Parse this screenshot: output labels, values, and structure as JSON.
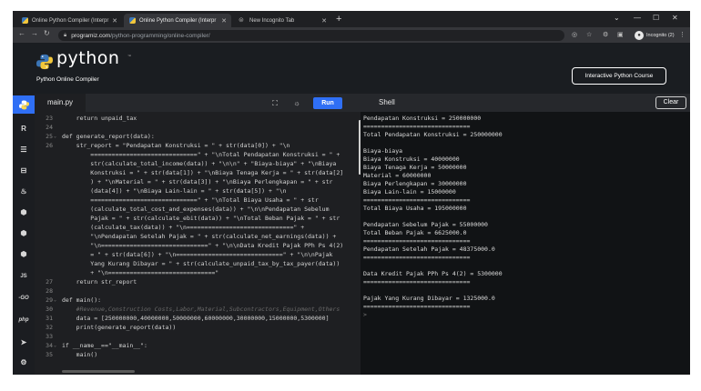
{
  "browser": {
    "tabs": [
      {
        "title": "Online Python Compiler (Interpr",
        "active": false
      },
      {
        "title": "Online Python Compiler (Interpr",
        "active": true
      },
      {
        "title": "New Incognito Tab",
        "active": false
      }
    ],
    "url_domain": "programiz.com",
    "url_path": "/python-programming/online-compiler/",
    "profile_label": "Incognito (2)"
  },
  "site": {
    "logo_text": "python",
    "logo_tm": "™",
    "subtitle": "Python Online Compiler",
    "course_button": "Interactive Python Course"
  },
  "sidebar": {
    "icons": [
      "python-icon",
      "r-icon",
      "sql-icon",
      "html-icon",
      "java-icon",
      "c-icon",
      "cpp-icon",
      "csharp-icon",
      "js-icon",
      "go-icon",
      "php-icon",
      "swift-icon",
      "rust-icon"
    ],
    "js_label": "JS",
    "go_label": "-GO",
    "php_label": "php"
  },
  "editor": {
    "filename": "main.py",
    "run_label": "Run",
    "lines": [
      {
        "n": "23",
        "text": "    return unpaid_tax"
      },
      {
        "n": "24",
        "text": ""
      },
      {
        "n": "25",
        "text": "def generate_report(data):",
        "fold": true
      },
      {
        "n": "26",
        "text": "    str_report = \"Pendapatan Konstruksi = \" + str(data[0]) + \"\\n"
      },
      {
        "n": "",
        "text": "        ==============================\" + \"\\nTotal Pendapatan Konstruksi = \" +"
      },
      {
        "n": "",
        "text": "        str(calculate_total_income(data)) + \"\\n\\n\" + \"Biaya-biaya\" + \"\\nBiaya"
      },
      {
        "n": "",
        "text": "        Konstruksi = \" + str(data[1]) + \"\\nBiaya Tenaga Kerja = \" + str(data[2]"
      },
      {
        "n": "",
        "text": "        ) + \"\\nMaterial = \" + str(data[3]) + \"\\nBiaya Perlengkapan = \" + str"
      },
      {
        "n": "",
        "text": "        (data[4]) + \"\\nBiaya Lain-lain = \" + str(data[5]) + \"\\n"
      },
      {
        "n": "",
        "text": "        ==============================\" + \"\\nTotal Biaya Usaha = \" + str"
      },
      {
        "n": "",
        "text": "        (calculate_total_cost_and_expenses(data)) + \"\\n\\nPendapatan Sebelum"
      },
      {
        "n": "",
        "text": "        Pajak = \" + str(calculate_ebit(data)) + \"\\nTotal Beban Pajak = \" + str"
      },
      {
        "n": "",
        "text": "        (calculate_tax(data)) + \"\\n==============================\" +"
      },
      {
        "n": "",
        "text": "        \"\\nPendapatan Setelah Pajak = \" + str(calculate_net_earnings(data)) +"
      },
      {
        "n": "",
        "text": "        \"\\n==============================\" + \"\\n\\nData Kredit Pajak PPh Ps 4(2)"
      },
      {
        "n": "",
        "text": "        = \" + str(data[6]) + \"\\n==============================\" + \"\\n\\nPajak"
      },
      {
        "n": "",
        "text": "        Yang Kurang Dibayar = \" + str(calculate_unpaid_tax_by_tax_payer(data))"
      },
      {
        "n": "",
        "text": "        + \"\\n==============================\""
      },
      {
        "n": "27",
        "text": "    return str_report"
      },
      {
        "n": "28",
        "text": ""
      },
      {
        "n": "29",
        "text": "def main():",
        "fold": true
      },
      {
        "n": "30",
        "text": "    #Revenue,Construction Costs,Labor,Material,Subcontractors,Equipment,Others",
        "comment": true
      },
      {
        "n": "31",
        "text": "    data = [250000000,40000000,50000000,60000000,30000000,15000000,5300000]"
      },
      {
        "n": "32",
        "text": "    print(generate_report(data))"
      },
      {
        "n": "33",
        "text": ""
      },
      {
        "n": "34",
        "text": "if __name__==\"__main__\":",
        "fold": true
      },
      {
        "n": "35",
        "text": "    main()"
      }
    ]
  },
  "shell": {
    "title": "Shell",
    "clear_label": "Clear",
    "lines": [
      "Pendapatan Konstruksi = 250000000",
      "==============================",
      "Total Pendapatan Konstruksi = 250000000",
      "",
      "Biaya-biaya",
      "Biaya Konstruksi = 40000000",
      "Biaya Tenaga Kerja = 50000000",
      "Material = 60000000",
      "Biaya Perlengkapan = 30000000",
      "Biaya Lain-lain = 15000000",
      "==============================",
      "Total Biaya Usaha = 195000000",
      "",
      "Pendapatan Sebelum Pajak = 55000000",
      "Total Beban Pajak = 6625000.0",
      "==============================",
      "Pendapatan Setelah Pajak = 48375000.0",
      "==============================",
      "",
      "Data Kredit Pajak PPh Ps 4(2) = 5300000",
      "==============================",
      "",
      "Pajak Yang Kurang Dibayar = 1325000.0",
      "==============================",
      ">"
    ]
  }
}
